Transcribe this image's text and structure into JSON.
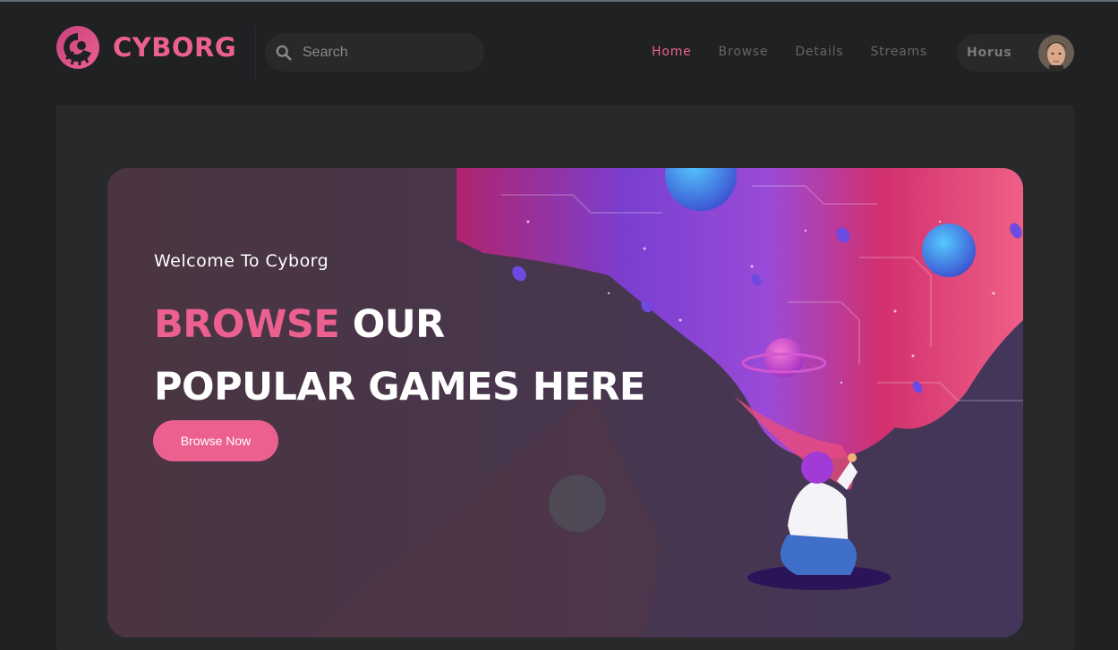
{
  "brand": {
    "name": "CYBORG",
    "accent_color": "#ec6090"
  },
  "search": {
    "placeholder": "Search"
  },
  "nav": {
    "items": [
      {
        "label": "Home",
        "active": true
      },
      {
        "label": "Browse",
        "active": false
      },
      {
        "label": "Details",
        "active": false
      },
      {
        "label": "Streams",
        "active": false
      }
    ]
  },
  "profile": {
    "name": "Horus"
  },
  "banner": {
    "welcome": "Welcome To Cyborg",
    "headline_highlight": "BROWSE",
    "headline_rest_line1": "OUR",
    "headline_line2": "POPULAR GAMES HERE",
    "button_label": "Browse Now"
  },
  "icons": {
    "logo": "cyborg-logo-icon",
    "search": "search-icon",
    "avatar": "user-avatar"
  }
}
